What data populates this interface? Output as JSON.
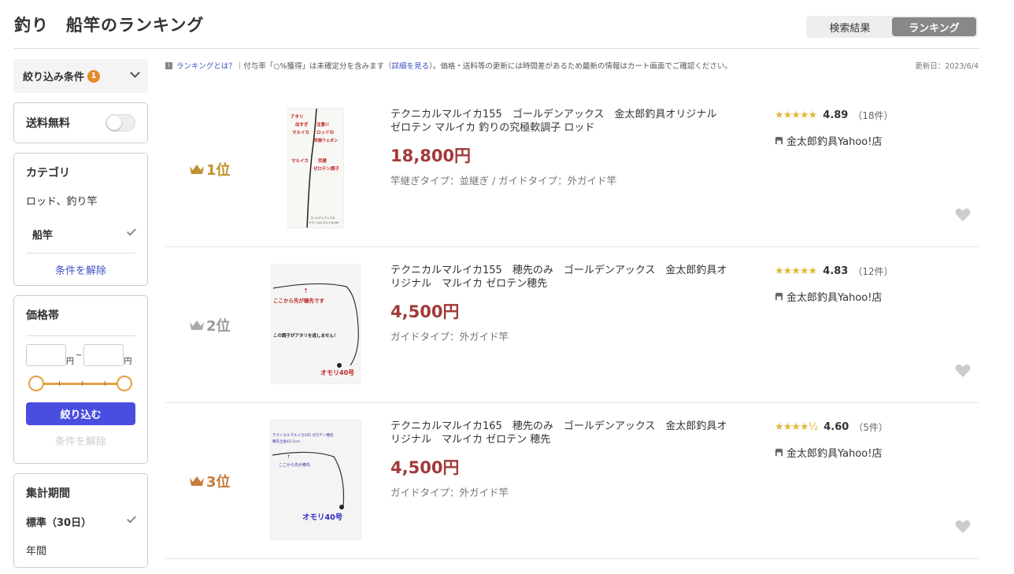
{
  "page": {
    "title": "釣り　船竿のランキング"
  },
  "view_toggle": {
    "search": "検索結果",
    "ranking": "ランキング"
  },
  "sidebar": {
    "filter_label": "絞り込み条件",
    "filter_count": "1",
    "free_shipping": "送料無料",
    "category": {
      "title": "カテゴリ",
      "parent": "ロッド、釣り竿",
      "child": "船竿",
      "clear": "条件を解除"
    },
    "price": {
      "title": "価格帯",
      "yen1": "円",
      "tilde": "~",
      "yen2": "円",
      "apply": "絞り込む",
      "clear": "条件を解除"
    },
    "period": {
      "title": "集計期間",
      "standard": "標準（30日）",
      "yearly": "年間"
    }
  },
  "notice": {
    "what_link": "ランキングとは？",
    "text1": "｜付与率「○%獲得」は未確定分を含みます（",
    "detail_link": "詳細を見る",
    "text2": "）。価格・送料等の更新には時間差があるため最新の情報はカート画面でご確認ください。",
    "updated": "更新日：2023/6/4"
  },
  "items": [
    {
      "rank": "1位",
      "crown_color": "#c0912e",
      "title": "テクニカルマルイカ155　ゴールデンアックス　金太郎釣具オリジナル　ゼロテン マルイカ 釣りの究極軟調子 ロッド",
      "price": "18,800円",
      "meta": "竿継ぎタイプ：並継ぎ / ガイドタイプ：外ガイド竿",
      "stars": "★★★★★",
      "rating": "4.89",
      "count": "（18件）",
      "shop": "金太郎釣具Yahoo!店",
      "img": {
        "l1": "アタリ",
        "l2": "出すぎ",
        "l3": "マルイカ",
        "l4": "注意!!",
        "l5": "ロッドの",
        "l6": "究極ウェポン",
        "l7": "マルイカ",
        "l8": "究極",
        "l9": "ゼロテン調子",
        "l10": "ゴールデンアックス",
        "l11": "テクニカルマルイカ155"
      }
    },
    {
      "rank": "2位",
      "crown_color": "#999999",
      "title": "テクニカルマルイカ155　穂先のみ　ゴールデンアックス　金太郎釣具オリジナル　マルイカ ゼロテン穂先",
      "price": "4,500円",
      "meta": "ガイドタイプ：外ガイド竿",
      "stars": "★★★★★",
      "rating": "4.83",
      "count": "（12件）",
      "shop": "金太郎釣具Yahoo!店",
      "img": {
        "l1": "ここから先が穂先です",
        "l2": "この調子がアタリを逃しません！",
        "l3": "オモリ40号"
      }
    },
    {
      "rank": "3位",
      "crown_color": "#c87a3a",
      "title": "テクニカルマルイカ165　穂先のみ　ゴールデンアックス　金太郎釣具オリジナル　マルイカ ゼロテン 穂先",
      "price": "4,500円",
      "meta": "ガイドタイプ：外ガイド竿",
      "stars": "★★★★½",
      "rating": "4.60",
      "count": "（5件）",
      "shop": "金太郎釣具Yahoo!店",
      "img": {
        "l1": "テクニカルマルイカ165 ゼロテン穂先",
        "l2": "穂先全長42.5cm",
        "l3": "ここから先が穂先",
        "l4": "オモリ40号"
      }
    }
  ],
  "icons": {
    "crown": "crown-icon",
    "heart": "heart-icon",
    "shop": "shop-icon",
    "chevron": "chevron-down-icon",
    "check": "check-icon",
    "info": "info-icon"
  }
}
